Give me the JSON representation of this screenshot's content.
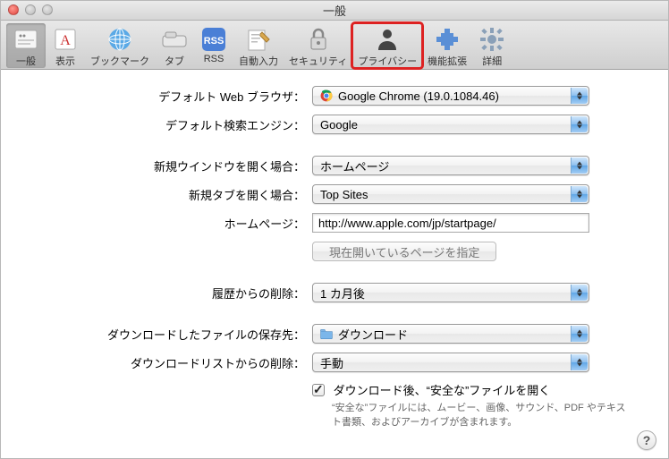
{
  "window": {
    "title": "一般"
  },
  "toolbar": {
    "items": [
      {
        "label": "一般",
        "icon": "general-icon"
      },
      {
        "label": "表示",
        "icon": "appearance-icon"
      },
      {
        "label": "ブックマーク",
        "icon": "bookmarks-icon"
      },
      {
        "label": "タブ",
        "icon": "tabs-icon"
      },
      {
        "label": "RSS",
        "icon": "rss-icon"
      },
      {
        "label": "自動入力",
        "icon": "autofill-icon"
      },
      {
        "label": "セキュリティ",
        "icon": "security-icon"
      },
      {
        "label": "プライバシー",
        "icon": "privacy-icon"
      },
      {
        "label": "機能拡張",
        "icon": "extensions-icon"
      },
      {
        "label": "詳細",
        "icon": "advanced-icon"
      }
    ],
    "selected_index": 0,
    "highlighted_index": 7
  },
  "labels": {
    "default_browser": "デフォルト Web ブラウザ：",
    "default_search": "デフォルト検索エンジン：",
    "new_window": "新規ウインドウを開く場合：",
    "new_tab": "新規タブを開く場合：",
    "homepage": "ホームページ：",
    "set_current": "現在開いているページを指定",
    "remove_history": "履歴からの削除：",
    "downloads_to": "ダウンロードしたファイルの保存先：",
    "remove_dlist": "ダウンロードリストからの削除：",
    "open_safe": "ダウンロード後、“安全な”ファイルを開く",
    "open_safe_desc": "“安全な”ファイルには、ムービー、画像、サウンド、PDF やテキスト書類、およびアーカイブが含まれます。"
  },
  "values": {
    "default_browser": "Google Chrome (19.0.1084.46)",
    "default_search": "Google",
    "new_window": "ホームページ",
    "new_tab": "Top Sites",
    "homepage_url": "http://www.apple.com/jp/startpage/",
    "remove_history": "1 カ月後",
    "downloads_to": "ダウンロード",
    "remove_dlist": "手動",
    "open_safe_checked": true
  }
}
